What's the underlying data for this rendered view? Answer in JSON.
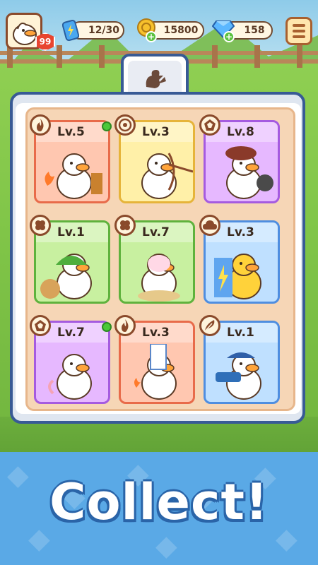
{
  "hud": {
    "player_level": "99",
    "energy": "12/30",
    "coins": "15800",
    "gems": "158",
    "menu_icon": "hamburger-menu-icon",
    "energy_icon": "battery-icon",
    "coin_icon": "coin-icon",
    "gem_icon": "diamond-icon"
  },
  "panel": {
    "tab_icon": "duck-feather-icon"
  },
  "cards": [
    {
      "level": "Lv.5",
      "type_icon": "fire-icon",
      "color": "red",
      "ready": true,
      "character": "fire-duck"
    },
    {
      "level": "Lv.3",
      "type_icon": "target-icon",
      "color": "yellow",
      "ready": false,
      "character": "archer-duck"
    },
    {
      "level": "Lv.8",
      "type_icon": "gem-icon",
      "color": "purple",
      "ready": false,
      "character": "chef-duck"
    },
    {
      "level": "Lv.1",
      "type_icon": "clover-icon",
      "color": "green",
      "ready": false,
      "character": "melon-duck"
    },
    {
      "level": "Lv.7",
      "type_icon": "clover-icon",
      "color": "green",
      "ready": false,
      "character": "egg-duck"
    },
    {
      "level": "Lv.3",
      "type_icon": "cloud-icon",
      "color": "blue",
      "ready": false,
      "character": "lightning-chick"
    },
    {
      "level": "Lv.7",
      "type_icon": "gem-icon",
      "color": "purple",
      "ready": true,
      "character": "swan-duck"
    },
    {
      "level": "Lv.3",
      "type_icon": "fire-icon",
      "color": "red",
      "ready": false,
      "character": "candle-duck"
    },
    {
      "level": "Lv.1",
      "type_icon": "feather-icon",
      "color": "blue",
      "ready": false,
      "character": "cannon-duck"
    }
  ],
  "banner": {
    "text": "Collect!"
  },
  "colors": {
    "panel_border": "#385a95",
    "red": "#e86b4a",
    "yellow": "#e6b43a",
    "purple": "#a55be0",
    "green": "#5fb23d",
    "blue": "#4f8ee0"
  }
}
